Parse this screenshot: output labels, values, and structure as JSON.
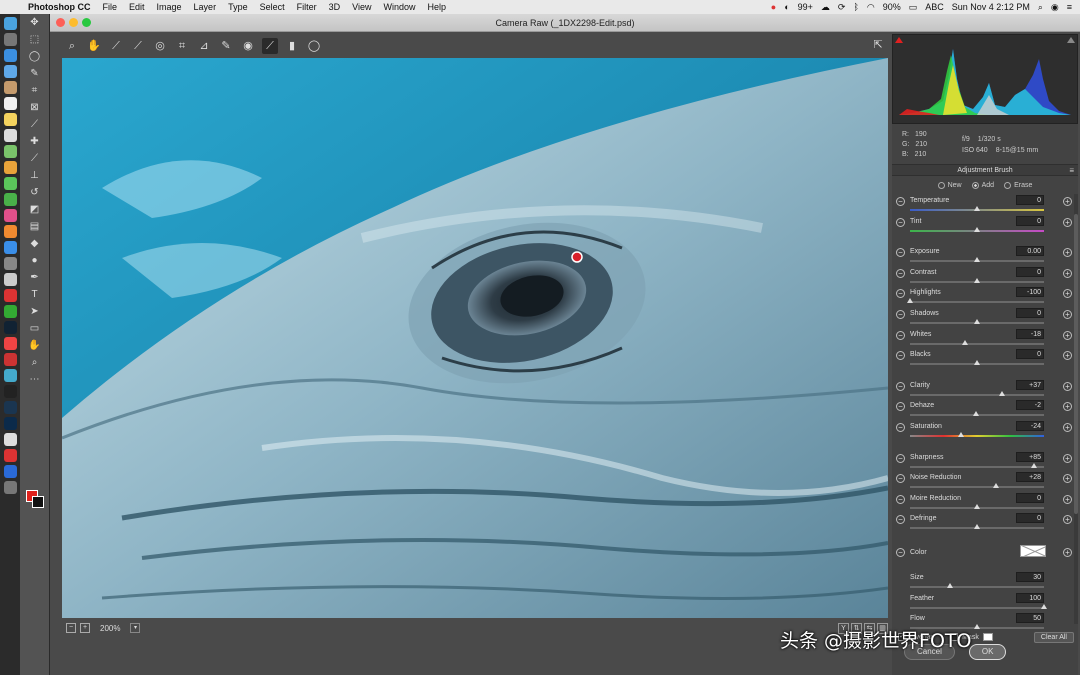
{
  "menubar": {
    "app_name": "Photoshop CC",
    "menus": [
      "File",
      "Edit",
      "Image",
      "Layer",
      "Type",
      "Select",
      "Filter",
      "3D",
      "View",
      "Window",
      "Help"
    ],
    "status_badge": "99+",
    "battery": "90%",
    "input_source": "ABC",
    "clock": "Sun Nov 4  2:12 PM"
  },
  "window": {
    "title": "Camera Raw (_1DX2298-Edit.psd)"
  },
  "info": {
    "r_label": "R:",
    "r_value": "190",
    "g_label": "G:",
    "g_value": "210",
    "b_label": "B:",
    "b_value": "210",
    "aperture": "f/9",
    "shutter": "1/320 s",
    "iso": "ISO 640",
    "lens": "8-15@15 mm"
  },
  "panel": {
    "title": "Adjustment Brush",
    "modes": [
      "New",
      "Add",
      "Erase"
    ],
    "selected_mode": "Add"
  },
  "sliders": [
    {
      "label": "Temperature",
      "value": "0",
      "pos": 0.5,
      "style": "temp"
    },
    {
      "label": "Tint",
      "value": "0",
      "pos": 0.5,
      "style": "tint"
    },
    {
      "label": "Exposure",
      "value": "0.00",
      "pos": 0.5,
      "style": ""
    },
    {
      "label": "Contrast",
      "value": "0",
      "pos": 0.5,
      "style": ""
    },
    {
      "label": "Highlights",
      "value": "-100",
      "pos": 0.0,
      "style": ""
    },
    {
      "label": "Shadows",
      "value": "0",
      "pos": 0.5,
      "style": ""
    },
    {
      "label": "Whites",
      "value": "-18",
      "pos": 0.41,
      "style": ""
    },
    {
      "label": "Blacks",
      "value": "0",
      "pos": 0.5,
      "style": ""
    },
    {
      "label": "Clarity",
      "value": "+37",
      "pos": 0.685,
      "style": ""
    },
    {
      "label": "Dehaze",
      "value": "-2",
      "pos": 0.49,
      "style": ""
    },
    {
      "label": "Saturation",
      "value": "-24",
      "pos": 0.38,
      "style": "sat"
    },
    {
      "label": "Sharpness",
      "value": "+85",
      "pos": 0.925,
      "style": ""
    },
    {
      "label": "Noise Reduction",
      "value": "+28",
      "pos": 0.64,
      "style": ""
    },
    {
      "label": "Moire Reduction",
      "value": "0",
      "pos": 0.5,
      "style": ""
    },
    {
      "label": "Defringe",
      "value": "0",
      "pos": 0.5,
      "style": ""
    }
  ],
  "color": {
    "label": "Color"
  },
  "brush": [
    {
      "label": "Size",
      "value": "30",
      "pos": 0.3
    },
    {
      "label": "Feather",
      "value": "100",
      "pos": 1.0
    },
    {
      "label": "Flow",
      "value": "50",
      "pos": 0.5
    }
  ],
  "panel_bottom": {
    "overlay": "Overlay",
    "mask": "Mask",
    "clear_all": "Clear All"
  },
  "status": {
    "zoom": "200%"
  },
  "buttons": {
    "cancel": "Cancel",
    "ok": "OK"
  },
  "watermark": "头条 @摄影世界FOTO",
  "colors": {
    "fg_swatch": "#e0231e",
    "bg_swatch": "#111111",
    "pin": "#d8202a"
  }
}
